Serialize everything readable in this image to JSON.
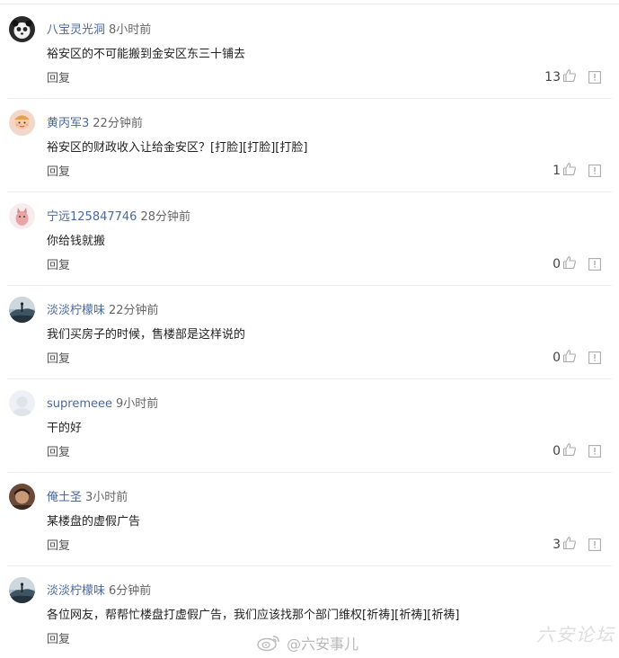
{
  "comments": [
    {
      "user": "八宝灵光洞",
      "time": "8小时前",
      "text": "裕安区的不可能搬到金安区东三十铺去",
      "reply_label": "回复",
      "likes": "13",
      "avatar": "panda"
    },
    {
      "user": "黄丙军3",
      "time": "22分钟前",
      "text": "裕安区的财政收入让给金安区？[打脸][打脸][打脸]",
      "reply_label": "回复",
      "likes": "1",
      "avatar": "face"
    },
    {
      "user": "宁远125847746",
      "time": "28分钟前",
      "text": "你给钱就搬",
      "reply_label": "回复",
      "likes": "0",
      "avatar": "cat"
    },
    {
      "user": "淡淡柠檬味",
      "time": "22分钟前",
      "text": "我们买房子的时候，售楼部是这样说的",
      "reply_label": "回复",
      "likes": "0",
      "avatar": "landscape"
    },
    {
      "user": "supremeee",
      "time": "9小时前",
      "text": "干的好",
      "reply_label": "回复",
      "likes": "0",
      "avatar": "default"
    },
    {
      "user": "俺土圣",
      "time": "3小时前",
      "text": "某楼盘的虚假广告",
      "reply_label": "回复",
      "likes": "3",
      "avatar": "portrait"
    },
    {
      "user": "淡淡柠檬味",
      "time": "6分钟前",
      "text": "各位网友，帮帮忙楼盘打虚假广告，我们应该找那个部门维权[祈祷][祈祷][祈祷]",
      "reply_label": "回复",
      "likes": "",
      "avatar": "landscape"
    }
  ],
  "watermark": {
    "text": "@六安事儿",
    "icon": "weibo-logo-icon"
  },
  "corner_mark": {
    "text": "六安论坛"
  },
  "colors": {
    "username": "#4a6a9a",
    "text": "#222222",
    "divider": "#ececec"
  }
}
